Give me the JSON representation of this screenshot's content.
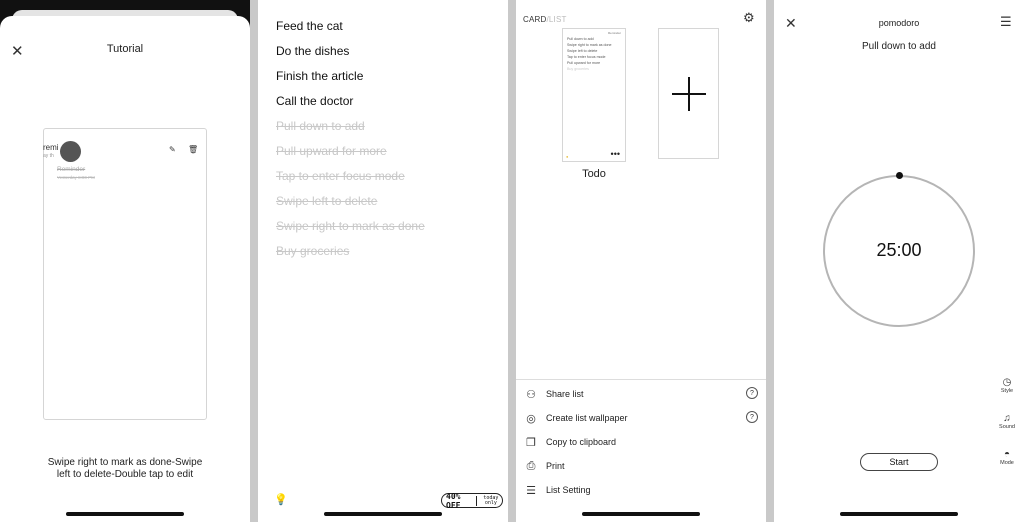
{
  "tutorial": {
    "title": "Tutorial",
    "card": {
      "reminder_label": "remi",
      "reminder_sub": "ay th",
      "item_title": "Reminder",
      "item_time": "Yesterday 8:00 PM"
    },
    "caption": "Swipe right to mark as done-Swipe left to delete-Double tap to edit",
    "page_dots": {
      "count": 8,
      "active_index": 3
    }
  },
  "todo_list": {
    "items": [
      {
        "text": "Feed the cat",
        "done": false
      },
      {
        "text": "Do the dishes",
        "done": false
      },
      {
        "text": "Finish the article",
        "done": false
      },
      {
        "text": "Call the doctor",
        "done": false
      },
      {
        "text": "Pull down to add",
        "done": true
      },
      {
        "text": "Pull upward for more",
        "done": true
      },
      {
        "text": "Tap to enter focus mode",
        "done": true
      },
      {
        "text": "Swipe left to delete",
        "done": true
      },
      {
        "text": "Swipe right to mark as done",
        "done": true
      },
      {
        "text": "Buy groceries",
        "done": true
      }
    ],
    "promo_discount": "40% OFF",
    "promo_note": "today only"
  },
  "cards_view": {
    "header_card": "CARD",
    "header_sep": "/",
    "header_list": "LIST",
    "mini_card": {
      "title": "Reminder",
      "lines": [
        "Pull down to add",
        "Swipe right to mark as done",
        "Swipe left to delete",
        "Tap to enter focus mode",
        "Pull upward for more"
      ],
      "faded_line": "Buy groceries"
    },
    "card_name": "Todo",
    "menu": [
      {
        "icon": "person-add-icon",
        "glyph": "⚇",
        "label": "Share list",
        "help": true
      },
      {
        "icon": "wallpaper-icon",
        "glyph": "◎",
        "label": "Create list wallpaper",
        "help": true
      },
      {
        "icon": "copy-icon",
        "glyph": "❐",
        "label": "Copy to clipboard",
        "help": false
      },
      {
        "icon": "printer-icon",
        "glyph": "⎙",
        "label": "Print",
        "help": false
      },
      {
        "icon": "sliders-icon",
        "glyph": "☰",
        "label": "List Setting",
        "help": false
      }
    ]
  },
  "pomodoro": {
    "title": "pomodoro",
    "subtitle": "Pull down to add",
    "time": "25:00",
    "side_buttons": [
      {
        "label": "Style",
        "glyph": "◷"
      },
      {
        "label": "Sound",
        "glyph": "♫"
      },
      {
        "label": "Mode",
        "glyph": "◓"
      }
    ],
    "start_label": "Start"
  }
}
